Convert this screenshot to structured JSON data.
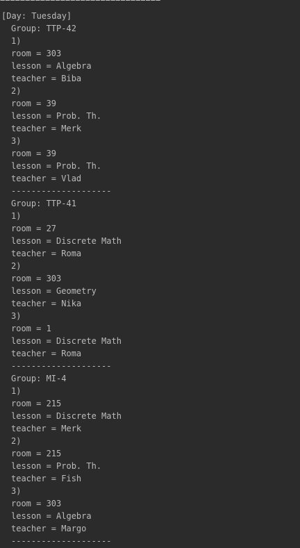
{
  "console": {
    "top_rule": "================================",
    "day_header": "[Day: Tuesday]",
    "separator": "--------------------",
    "groups": [
      {
        "name": "Group: TTP-42",
        "entries": [
          {
            "index": "1)",
            "room": "room = 303",
            "lesson": "lesson = Algebra",
            "teacher": "teacher = Biba"
          },
          {
            "index": "2)",
            "room": "room = 39",
            "lesson": "lesson = Prob. Th.",
            "teacher": "teacher = Merk"
          },
          {
            "index": "3)",
            "room": "room = 39",
            "lesson": "lesson = Prob. Th.",
            "teacher": "teacher = Vlad"
          }
        ]
      },
      {
        "name": "Group: TTP-41",
        "entries": [
          {
            "index": "1)",
            "room": "room = 27",
            "lesson": "lesson = Discrete Math",
            "teacher": "teacher = Roma"
          },
          {
            "index": "2)",
            "room": "room = 303",
            "lesson": "lesson = Geometry",
            "teacher": "teacher = Nika"
          },
          {
            "index": "3)",
            "room": "room = 1",
            "lesson": "lesson = Discrete Math",
            "teacher": "teacher = Roma"
          }
        ]
      },
      {
        "name": "Group: MI-4",
        "entries": [
          {
            "index": "1)",
            "room": "room = 215",
            "lesson": "lesson = Discrete Math",
            "teacher": "teacher = Merk"
          },
          {
            "index": "2)",
            "room": "room = 215",
            "lesson": "lesson = Prob. Th.",
            "teacher": "teacher = Fish"
          },
          {
            "index": "3)",
            "room": "room = 303",
            "lesson": "lesson = Algebra",
            "teacher": "teacher = Margo"
          }
        ]
      }
    ]
  }
}
